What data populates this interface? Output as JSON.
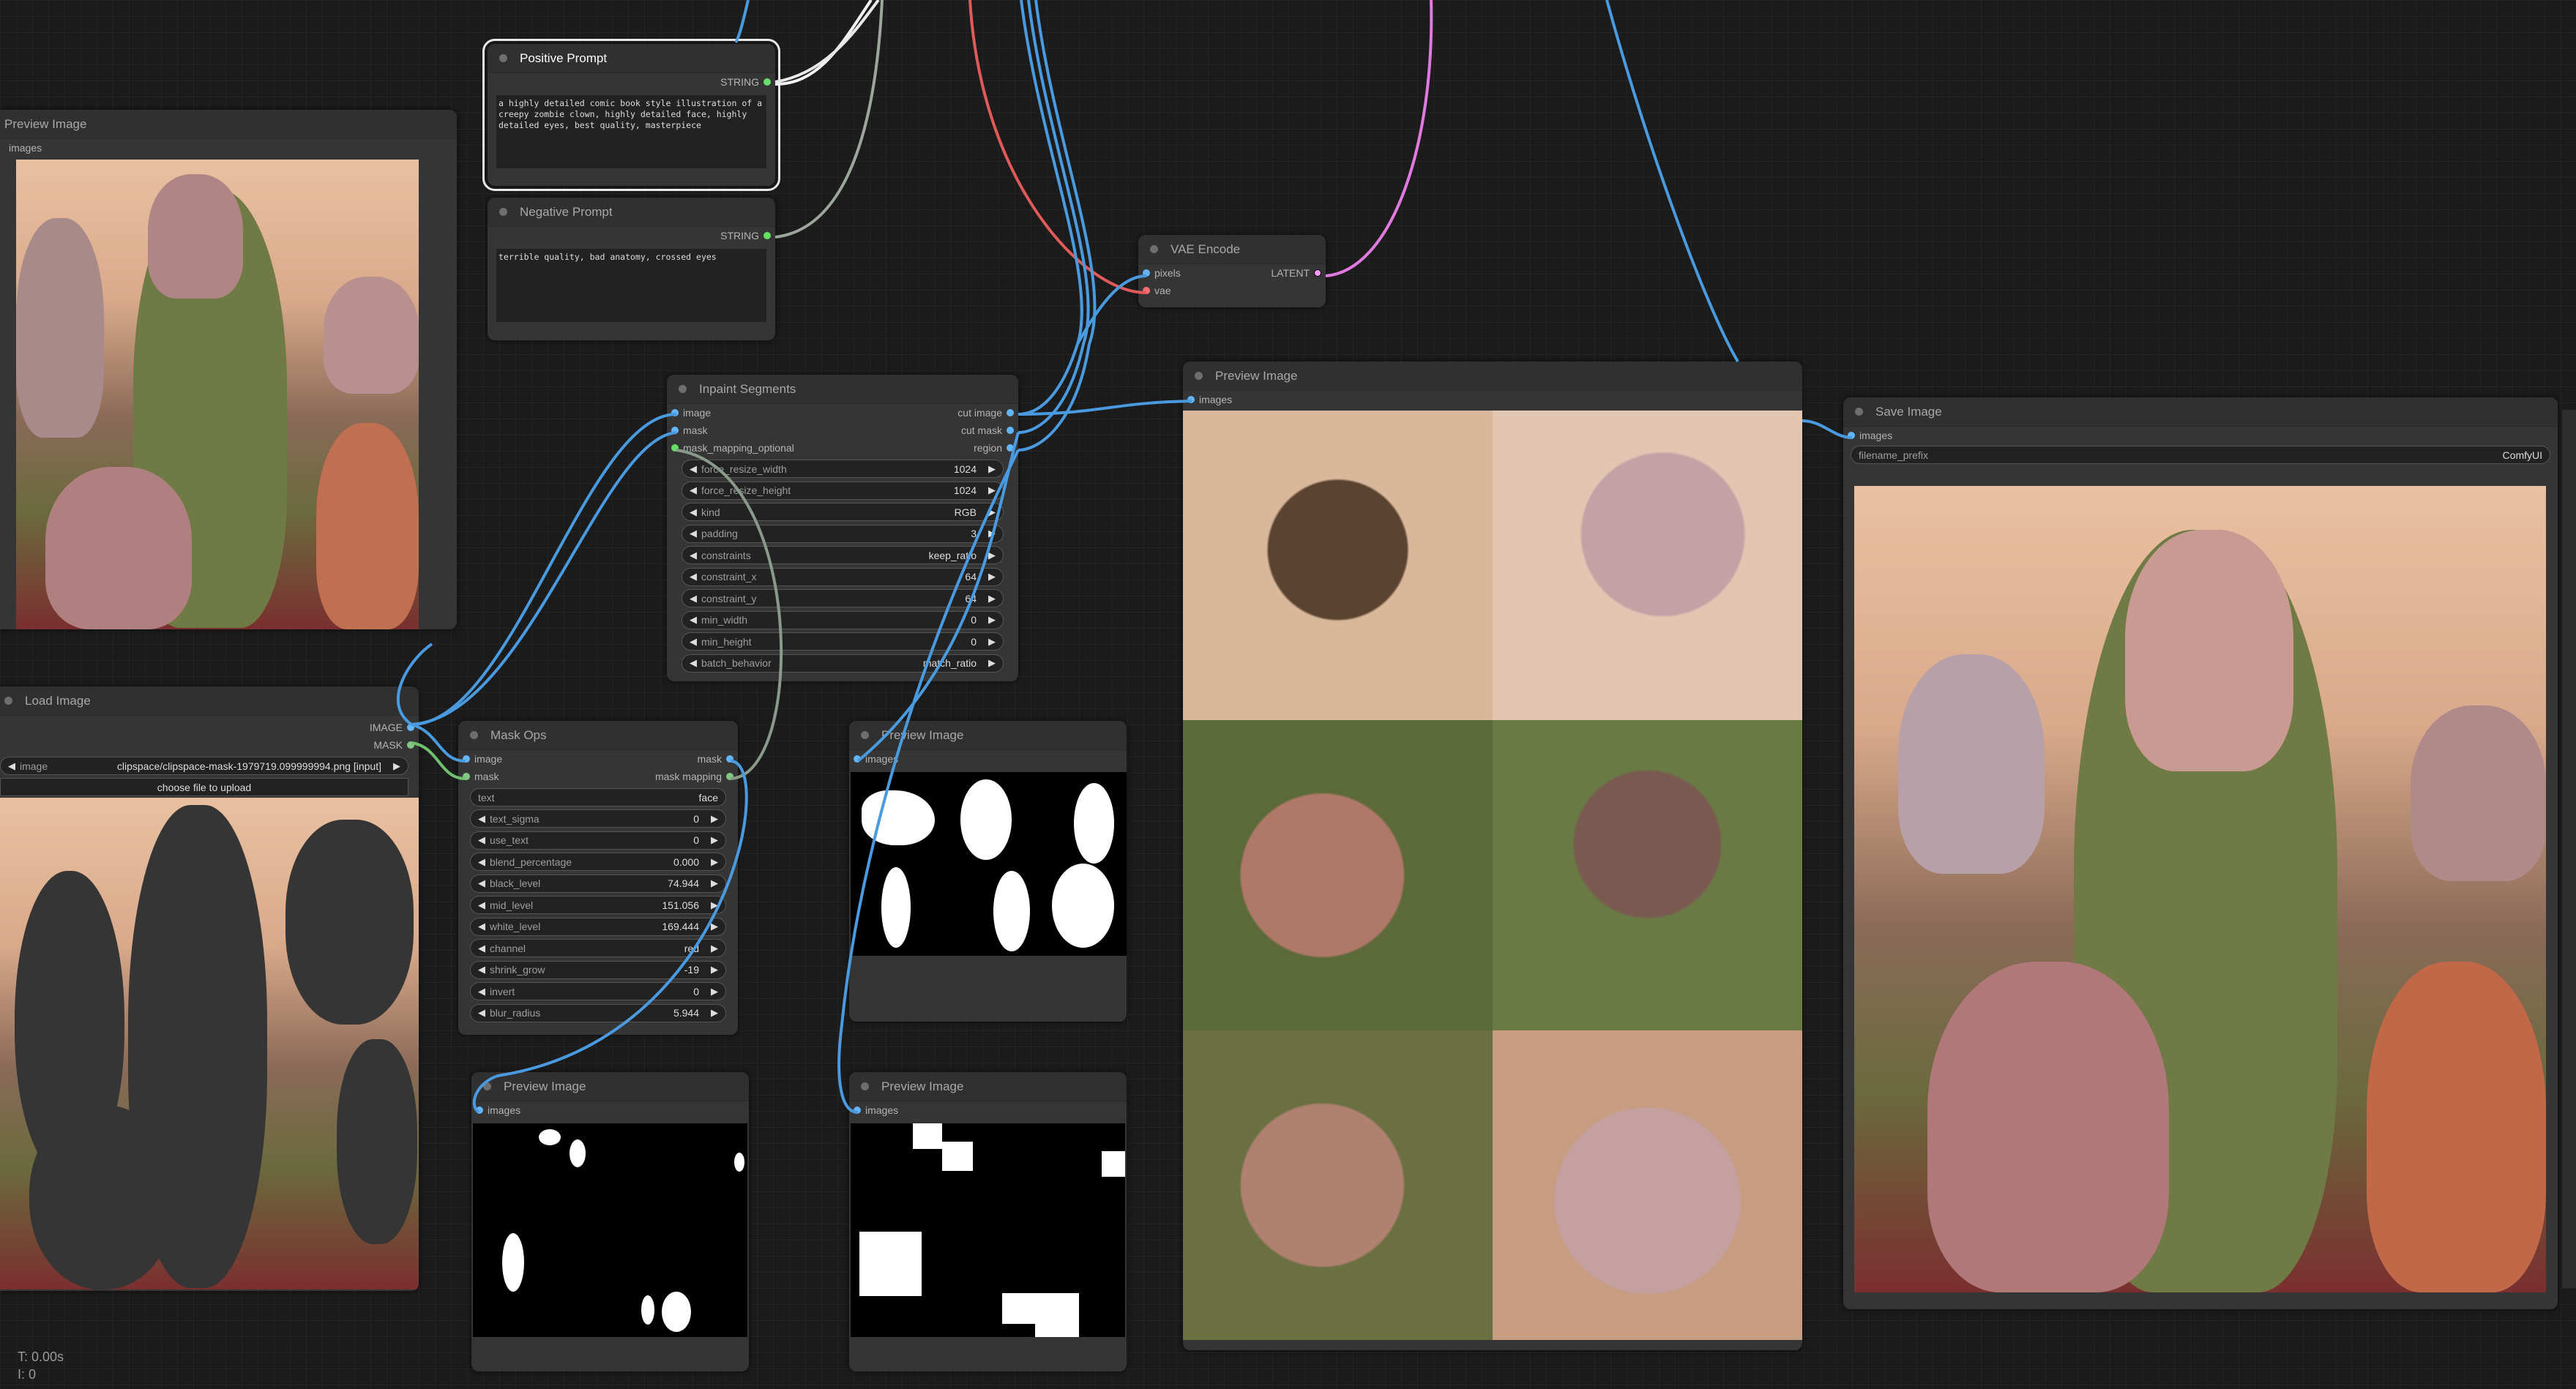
{
  "colors": {
    "image": "#64b5f6",
    "mask": "#81c784",
    "string": "#66e066",
    "vae": "#ff6e6e",
    "latent": "#ff9cf9",
    "canvas": "#1b1b1b",
    "node": "#353535"
  },
  "nodes": {
    "preview_top_left": {
      "title": "Preview Image",
      "input": "images"
    },
    "positive_prompt": {
      "title": "Positive Prompt",
      "output": "STRING",
      "text": "a highly detailed comic book style illustration of a creepy zombie clown, highly detailed face, highly detailed eyes, best quality, masterpiece"
    },
    "negative_prompt": {
      "title": "Negative Prompt",
      "output": "STRING",
      "text": "terrible quality, bad anatomy, crossed eyes"
    },
    "vae_encode": {
      "title": "VAE Encode",
      "inputs": [
        "pixels",
        "vae"
      ],
      "output": "LATENT"
    },
    "inpaint_segments": {
      "title": "Inpaint Segments",
      "inputs": [
        "image",
        "mask",
        "mask_mapping_optional"
      ],
      "outputs": [
        "cut image",
        "cut mask",
        "region"
      ],
      "widgets": [
        [
          "force_resize_width",
          "1024"
        ],
        [
          "force_resize_height",
          "1024"
        ],
        [
          "kind",
          "RGB"
        ],
        [
          "padding",
          "3"
        ],
        [
          "constraints",
          "keep_ratio"
        ],
        [
          "constraint_x",
          "64"
        ],
        [
          "constraint_y",
          "64"
        ],
        [
          "min_width",
          "0"
        ],
        [
          "min_height",
          "0"
        ],
        [
          "batch_behavior",
          "match_ratio"
        ]
      ]
    },
    "load_image": {
      "title": "Load Image",
      "outputs": [
        "IMAGE",
        "MASK"
      ],
      "image_label": "image",
      "image_value": "clipspace/clipspace-mask-1979719.099999994.png [input]",
      "upload_label": "choose file to upload"
    },
    "mask_ops": {
      "title": "Mask Ops",
      "inputs": [
        "image",
        "mask"
      ],
      "outputs": [
        "mask",
        "mask mapping"
      ],
      "text_label": "text",
      "text_value": "face",
      "widgets": [
        [
          "text_sigma",
          "0"
        ],
        [
          "use_text",
          "0"
        ],
        [
          "blend_percentage",
          "0.000"
        ],
        [
          "black_level",
          "74.944"
        ],
        [
          "mid_level",
          "151.056"
        ],
        [
          "white_level",
          "169.444"
        ],
        [
          "channel",
          "red"
        ],
        [
          "shrink_grow",
          "-19"
        ],
        [
          "invert",
          "0"
        ],
        [
          "blur_radius",
          "5.944"
        ]
      ]
    },
    "preview_mask_blobs": {
      "title": "Preview Image",
      "input": "images"
    },
    "preview_bottom_mid": {
      "title": "Preview Image",
      "input": "images"
    },
    "preview_bottom_right": {
      "title": "Preview Image",
      "input": "images"
    },
    "preview_grid": {
      "title": "Preview Image",
      "input": "images"
    },
    "save_image": {
      "title": "Save Image",
      "input": "images",
      "prefix_label": "filename_prefix",
      "prefix_value": "ComfyUI"
    }
  },
  "stats": {
    "time": "T: 0.00s",
    "iterations": "I: 0"
  }
}
